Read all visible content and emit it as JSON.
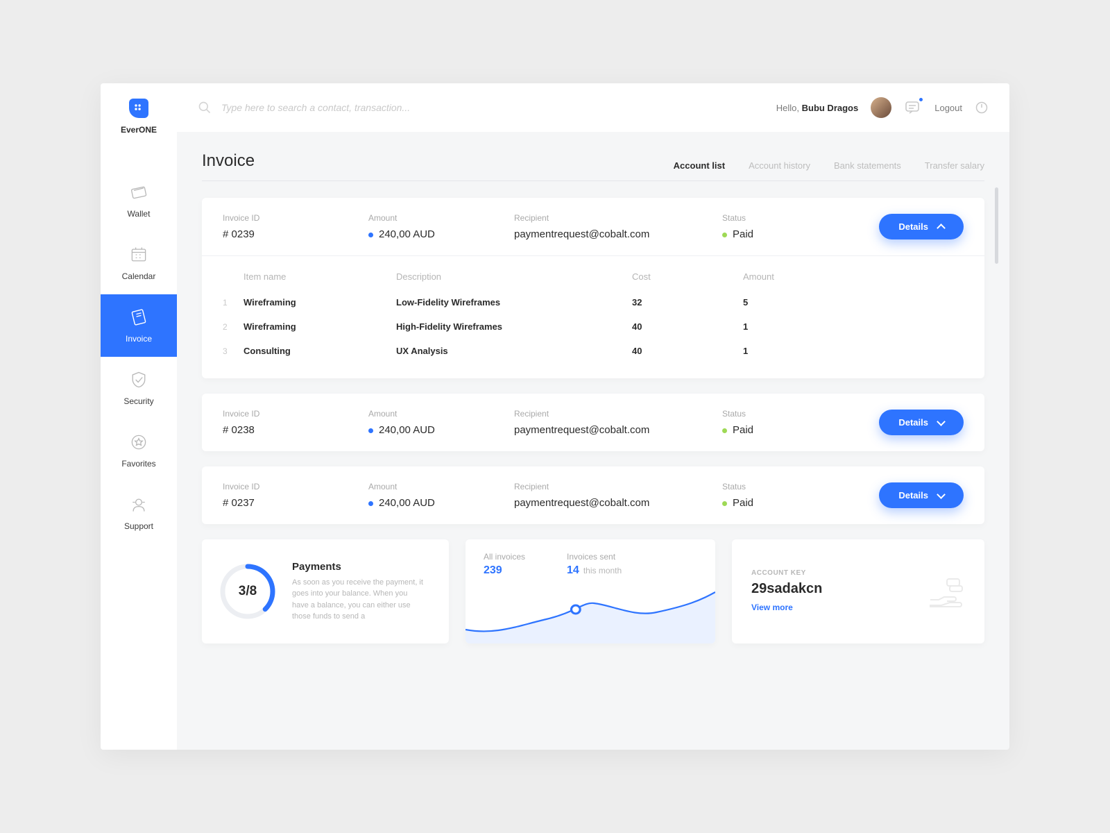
{
  "brand": "EverONE",
  "nav": [
    {
      "label": "Wallet"
    },
    {
      "label": "Calendar"
    },
    {
      "label": "Invoice",
      "active": true
    },
    {
      "label": "Security"
    },
    {
      "label": "Favorites"
    },
    {
      "label": "Support"
    }
  ],
  "topbar": {
    "search_placeholder": "Type here to search a contact, transaction...",
    "greeting_prefix": "Hello, ",
    "user_name": "Bubu Dragos",
    "logout": "Logout"
  },
  "page": {
    "title": "Invoice",
    "tabs": [
      {
        "label": "Account list",
        "active": true
      },
      {
        "label": "Account history"
      },
      {
        "label": "Bank statements"
      },
      {
        "label": "Transfer salary"
      }
    ]
  },
  "labels": {
    "invoice_id": "Invoice ID",
    "amount": "Amount",
    "recipient": "Recipient",
    "status": "Status",
    "details": "Details",
    "item_name": "Item name",
    "description": "Description",
    "cost": "Cost"
  },
  "invoices": [
    {
      "id": "# 0239",
      "amount": "240,00 AUD",
      "recipient": "paymentrequest@cobalt.com",
      "status": "Paid",
      "expanded": true,
      "items": [
        {
          "n": "1",
          "name": "Wireframing",
          "desc": "Low-Fidelity Wireframes",
          "cost": "32",
          "amount": "5"
        },
        {
          "n": "2",
          "name": "Wireframing",
          "desc": "High-Fidelity Wireframes",
          "cost": "40",
          "amount": "1"
        },
        {
          "n": "3",
          "name": "Consulting",
          "desc": "UX Analysis",
          "cost": "40",
          "amount": "1"
        }
      ]
    },
    {
      "id": "# 0238",
      "amount": "240,00 AUD",
      "recipient": "paymentrequest@cobalt.com",
      "status": "Paid",
      "expanded": false
    },
    {
      "id": "# 0237",
      "amount": "240,00 AUD",
      "recipient": "paymentrequest@cobalt.com",
      "status": "Paid",
      "expanded": false
    }
  ],
  "widget_payments": {
    "title": "Payments",
    "ratio": "3/8",
    "progress_pct": 37.5,
    "text": "As soon as you receive the payment, it goes into your balance. When you have a balance, you can either use those funds to send a"
  },
  "widget_chart": {
    "all_label": "All invoices",
    "all_value": "239",
    "sent_label": "Invoices sent",
    "sent_value": "14",
    "sent_suffix": "this month"
  },
  "widget_key": {
    "label": "ACCOUNT KEY",
    "value": "29sadakcn",
    "link": "View more"
  },
  "chart_data": {
    "type": "line",
    "title": "Invoices sent",
    "x": [
      0,
      1,
      2,
      3,
      4,
      5,
      6
    ],
    "values": [
      8,
      6,
      10,
      16,
      12,
      14,
      22
    ],
    "ylim": [
      0,
      25
    ],
    "highlight_index": 3
  },
  "colors": {
    "accent": "#2e74ff",
    "success": "#9ed955",
    "muted": "#b7b7b7"
  }
}
